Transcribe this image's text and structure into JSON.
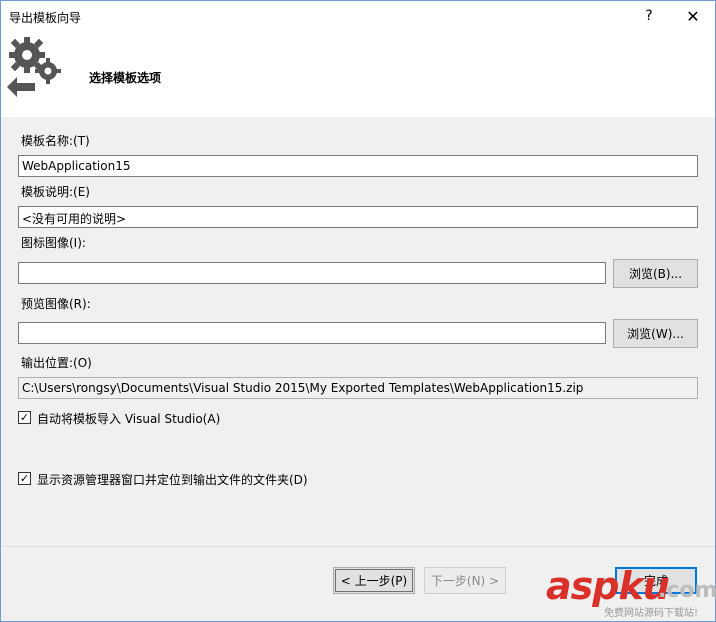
{
  "window": {
    "title": "导出模板向导",
    "help_glyph": "?",
    "close_glyph": "✕"
  },
  "header": {
    "title": "选择模板选项",
    "icon": "gears-export-icon"
  },
  "form": {
    "template_name_label": "模板名称:(T)",
    "template_name_value": "WebApplication15",
    "description_label": "模板说明:(E)",
    "description_value": "<没有可用的说明>",
    "icon_image_label": "图标图像(I):",
    "icon_image_value": "",
    "icon_browse_label": "浏览(B)...",
    "preview_image_label": "预览图像(R):",
    "preview_image_value": "",
    "preview_browse_label": "浏览(W)...",
    "output_location_label": "输出位置:(O)",
    "output_location_value": "C:\\Users\\rongsy\\Documents\\Visual Studio 2015\\My Exported Templates\\WebApplication15.zip",
    "auto_import_checked": true,
    "auto_import_label": "自动将模板导入 Visual Studio(A)",
    "show_explorer_checked": true,
    "show_explorer_label": "显示资源管理器窗口并定位到输出文件的文件夹(D)"
  },
  "buttons": {
    "prev_label": "< 上一步(P)",
    "next_label": "下一步(N) >",
    "finish_label": "完成"
  },
  "watermark": {
    "main": "aspku",
    "tld": ".com",
    "sub": "免费网站源码下载站!"
  },
  "colors": {
    "focus_border": "#0078d7",
    "watermark_red": "#d9302a"
  }
}
